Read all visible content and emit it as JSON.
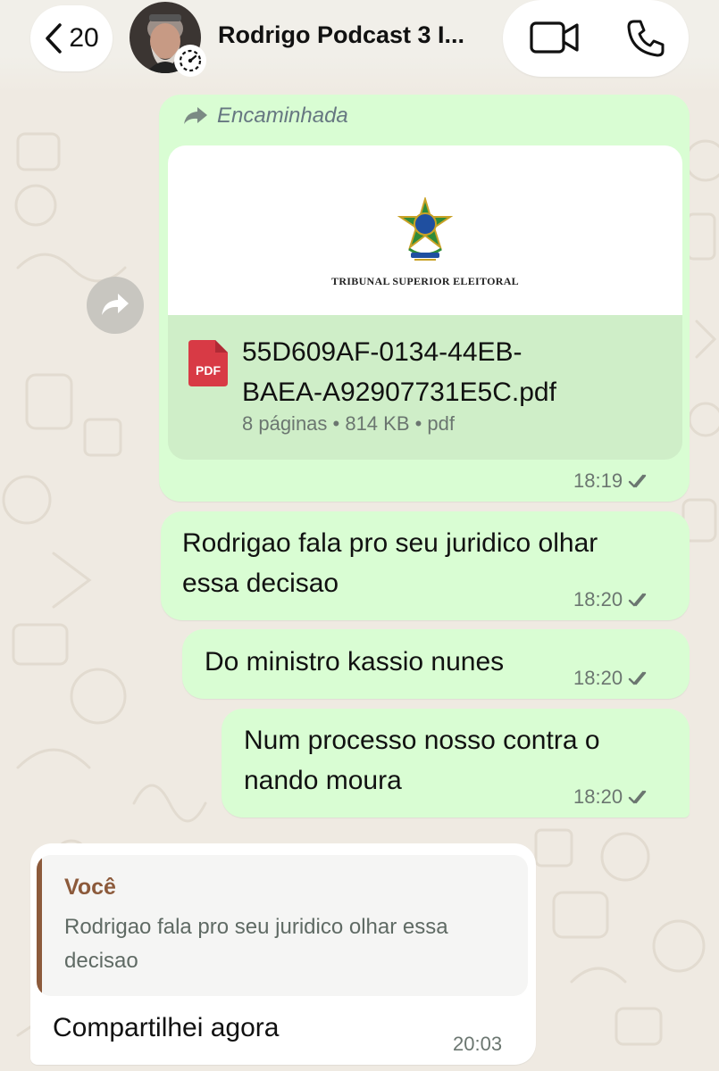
{
  "header": {
    "back_count": "20",
    "contact_name": "Rodrigo Podcast 3 I...",
    "icons": {
      "back": "chevron-left-icon",
      "status": "disappearing-timer-icon",
      "video": "video-camera-icon",
      "phone": "phone-icon"
    }
  },
  "messages": {
    "forwarded_doc": {
      "forwarded_label": "Encaminhada",
      "preview_title": "TRIBUNAL SUPERIOR ELEITORAL",
      "pdf_badge": "PDF",
      "file_name_line1": "55D609AF-0134-44EB-",
      "file_name_line2": "BAEA-A92907731E5C.pdf",
      "file_meta": "8 páginas • 814 KB • pdf",
      "time": "18:19"
    },
    "msg1": {
      "line1": "Rodrigao fala pro seu juridico olhar",
      "line2": "essa decisao",
      "time": "18:20"
    },
    "msg2": {
      "text": "Do ministro kassio nunes",
      "time": "18:20"
    },
    "msg3": {
      "line1": "Num processo nosso contra o",
      "line2": "nando moura",
      "time": "18:20"
    },
    "reply": {
      "quote_author": "Você",
      "quote_line1": "Rodrigao fala pro seu juridico olhar essa",
      "quote_line2": "decisao",
      "text": "Compartilhei agora",
      "time": "20:03"
    }
  },
  "colors": {
    "chat_background": "#efeae2",
    "outgoing_bubble": "#d9fdd3",
    "incoming_bubble": "#ffffff",
    "quote_accent": "#8c5a3b",
    "pdf_red": "#d83a45"
  }
}
